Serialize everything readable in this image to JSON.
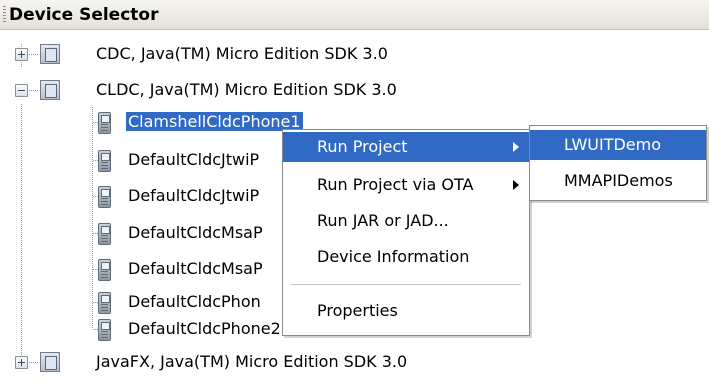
{
  "panel": {
    "title": "Device Selector"
  },
  "tree": {
    "platforms": [
      {
        "label": "CDC, Java(TM) Micro Edition SDK 3.0",
        "expanded": false
      },
      {
        "label": "CLDC, Java(TM) Micro Edition SDK 3.0",
        "expanded": true
      },
      {
        "label": "JavaFX, Java(TM) Micro Edition SDK 3.0",
        "expanded": false
      }
    ],
    "devices": [
      "ClamshellCldcPhone1",
      "DefaultCldcJtwiP",
      "DefaultCldcJtwiP",
      "DefaultCldcMsaP",
      "DefaultCldcMsaP",
      "DefaultCldcPhon",
      "DefaultCldcPhone2"
    ]
  },
  "context_menu": {
    "items": [
      "Run Project",
      "Run Project via OTA",
      "Run JAR or JAD...",
      "Device Information",
      "Properties"
    ]
  },
  "submenu": {
    "items": [
      "LWUITDemo",
      "MMAPIDemos"
    ]
  }
}
